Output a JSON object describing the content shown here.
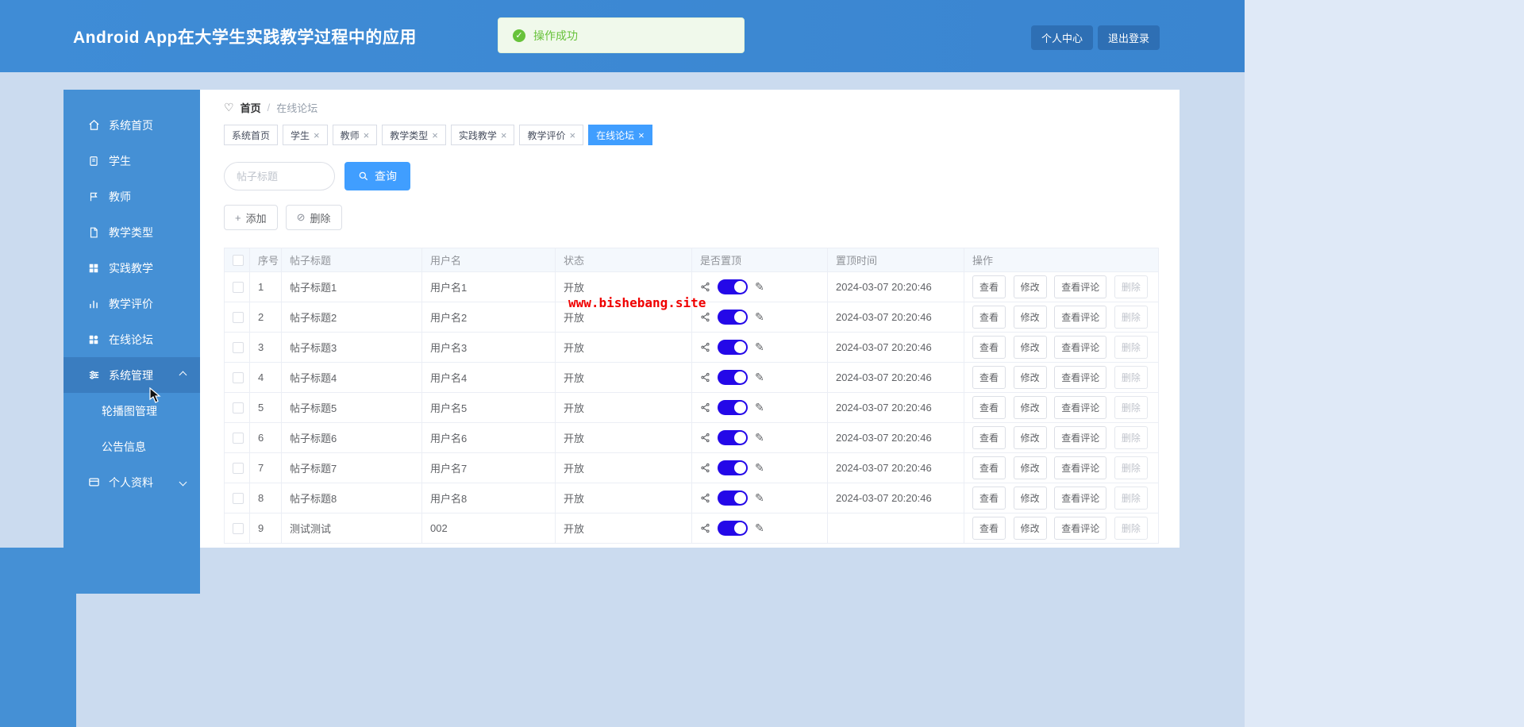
{
  "header": {
    "title": "Android App在大学生实践教学过程中的应用",
    "toast_text": "操作成功",
    "profile_label": "个人中心",
    "logout_label": "退出登录"
  },
  "breadcrumb": {
    "home": "首页",
    "separator": "/",
    "current": "在线论坛"
  },
  "sidebar": {
    "items": [
      {
        "label": "系统首页"
      },
      {
        "label": "学生"
      },
      {
        "label": "教师"
      },
      {
        "label": "教学类型"
      },
      {
        "label": "实践教学"
      },
      {
        "label": "教学评价"
      },
      {
        "label": "在线论坛"
      },
      {
        "label": "系统管理"
      },
      {
        "label": "个人资料"
      }
    ],
    "subitems": [
      {
        "label": "轮播图管理"
      },
      {
        "label": "公告信息"
      }
    ]
  },
  "tabs": [
    {
      "label": "系统首页"
    },
    {
      "label": "学生"
    },
    {
      "label": "教师"
    },
    {
      "label": "教学类型"
    },
    {
      "label": "实践教学"
    },
    {
      "label": "教学评价"
    },
    {
      "label": "在线论坛"
    }
  ],
  "toolbar": {
    "search_placeholder": "帖子标题",
    "search_label": "查询",
    "add_label": "添加",
    "delete_label": "删除"
  },
  "table": {
    "columns": [
      "序号",
      "帖子标题",
      "用户名",
      "状态",
      "是否置顶",
      "置顶时间",
      "操作"
    ],
    "action_labels": [
      "查看",
      "修改",
      "查看评论",
      "删除"
    ],
    "rows": [
      {
        "index": "1",
        "title": "帖子标题1",
        "user": "用户名1",
        "status": "开放",
        "time": "2024-03-07 20:20:46"
      },
      {
        "index": "2",
        "title": "帖子标题2",
        "user": "用户名2",
        "status": "开放",
        "time": "2024-03-07 20:20:46"
      },
      {
        "index": "3",
        "title": "帖子标题3",
        "user": "用户名3",
        "status": "开放",
        "time": "2024-03-07 20:20:46"
      },
      {
        "index": "4",
        "title": "帖子标题4",
        "user": "用户名4",
        "status": "开放",
        "time": "2024-03-07 20:20:46"
      },
      {
        "index": "5",
        "title": "帖子标题5",
        "user": "用户名5",
        "status": "开放",
        "time": "2024-03-07 20:20:46"
      },
      {
        "index": "6",
        "title": "帖子标题6",
        "user": "用户名6",
        "status": "开放",
        "time": "2024-03-07 20:20:46"
      },
      {
        "index": "7",
        "title": "帖子标题7",
        "user": "用户名7",
        "status": "开放",
        "time": "2024-03-07 20:20:46"
      },
      {
        "index": "8",
        "title": "帖子标题8",
        "user": "用户名8",
        "status": "开放",
        "time": "2024-03-07 20:20:46"
      },
      {
        "index": "9",
        "title": "测试测试",
        "user": "002",
        "status": "开放",
        "time": ""
      }
    ]
  },
  "icons": {
    "plus": "+",
    "ban": "⊘",
    "close": "×",
    "check": "✓",
    "heart": "♡",
    "pencil": "✎"
  },
  "watermark": "www.bishebang.site",
  "colors": {
    "header_blue": "#3a85d0",
    "sidebar_blue": "#4590d5",
    "accent": "#409eff",
    "toggle_on": "#2408e8",
    "success_green": "#67c23a",
    "page_bg": "#cbdbef",
    "watermark_red": "#f00000"
  }
}
